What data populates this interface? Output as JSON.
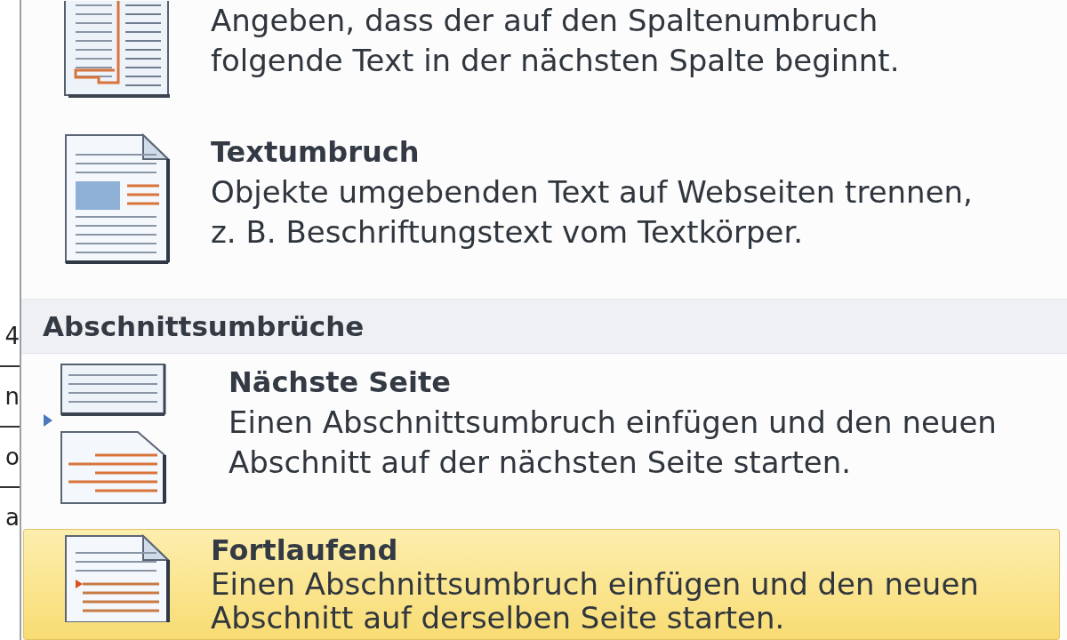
{
  "document_edge": {
    "cells": [
      {
        "text": "4",
        "rule_below": true
      },
      {
        "text": "n",
        "rule_below": true
      },
      {
        "text": "o",
        "rule_below": true
      },
      {
        "text": "a",
        "rule_below": false
      }
    ]
  },
  "menu": {
    "items": [
      {
        "kind": "column-break",
        "selected": false,
        "description": "Angeben, dass der auf den Spaltenumbruch folgende Text in der nächsten Spalte beginnt."
      },
      {
        "kind": "text-wrap",
        "selected": false,
        "title": "Textumbruch",
        "description": "Objekte umgebenden Text auf Webseiten trennen, z. B. Beschriftungstext vom Textkörper."
      },
      {
        "kind": "section-header",
        "title": "Abschnittsumbrüche"
      },
      {
        "kind": "next-page",
        "selected": false,
        "title": "Nächste Seite",
        "description": "Einen Abschnittsumbruch einfügen und den neuen Abschnitt auf der nächsten Seite starten."
      },
      {
        "kind": "continuous",
        "selected": true,
        "title": "Fortlaufend",
        "description": "Einen Abschnittsumbruch einfügen und den neuen Abschnitt auf derselben Seite starten."
      }
    ]
  }
}
